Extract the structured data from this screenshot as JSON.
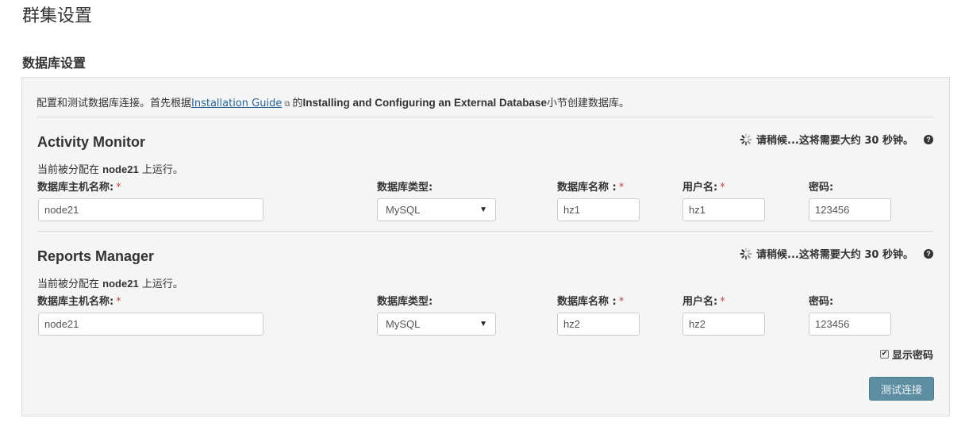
{
  "page_title": "群集设置",
  "section_title": "数据库设置",
  "intro": {
    "prefix": "配置和测试数据库连接。首先根据",
    "link": "Installation Guide",
    "middle": "的",
    "bold": "Installing and Configuring an External Database",
    "suffix": "小节创建数据库。"
  },
  "icons": {
    "external_link": "external-link-icon",
    "spinner": "spinner-icon",
    "help": "question-circle-icon",
    "checkbox": "checkbox-icon"
  },
  "field_labels": {
    "host": "数据库主机名称:",
    "type": "数据库类型:",
    "db_name": "数据库名称 :",
    "user": "用户名:",
    "password": "密码:",
    "required_mark": "*"
  },
  "services": [
    {
      "title": "Activity Monitor",
      "wait_text": "请稍候...这将需要大约 30 秒钟。",
      "help_glyph": "?",
      "assigned_prefix": "当前被分配在",
      "assigned_host": "node21",
      "assigned_suffix": "上运行。",
      "host": "node21",
      "type": "MySQL",
      "db_name": "hz1",
      "user": "hz1",
      "password": "123456"
    },
    {
      "title": "Reports Manager",
      "wait_text": "请稍候...这将需要大约 30 秒钟。",
      "help_glyph": "?",
      "assigned_prefix": "当前被分配在",
      "assigned_host": "node21",
      "assigned_suffix": "上运行。",
      "host": "node21",
      "type": "MySQL",
      "db_name": "hz2",
      "user": "hz2",
      "password": "123456"
    }
  ],
  "show_password": {
    "label": "显示密码",
    "checked": true,
    "check_glyph": "✔"
  },
  "test_button": "测试连接",
  "colors": {
    "panel_bg": "#f5f5f5",
    "link": "#2a6496",
    "required": "#b94a48",
    "button": "#5e8ea2"
  }
}
